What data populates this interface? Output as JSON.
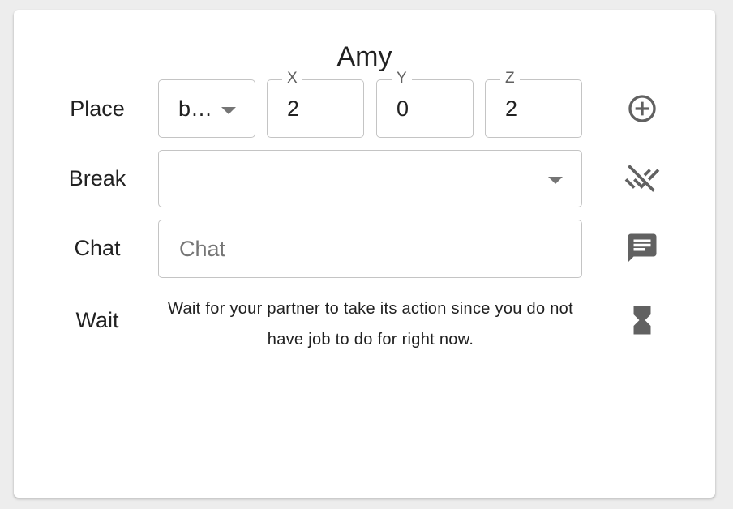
{
  "agent_name": "Amy",
  "place": {
    "label": "Place",
    "block_value": "b…",
    "x": {
      "legend": "X",
      "value": "2"
    },
    "y": {
      "legend": "Y",
      "value": "0"
    },
    "z": {
      "legend": "Z",
      "value": "2"
    },
    "action_icon": "add-circle-icon"
  },
  "break": {
    "label": "Break",
    "value": "",
    "action_icon": "remove-done-icon"
  },
  "chat": {
    "label": "Chat",
    "placeholder": "Chat",
    "value": "",
    "action_icon": "chat-icon"
  },
  "wait": {
    "label": "Wait",
    "message": "Wait for your partner to take its action since you do not have job to do for right now.",
    "action_icon": "hourglass-icon"
  },
  "colors": {
    "icon": "#616161",
    "border": "#c4c4c4",
    "text": "#212121"
  }
}
